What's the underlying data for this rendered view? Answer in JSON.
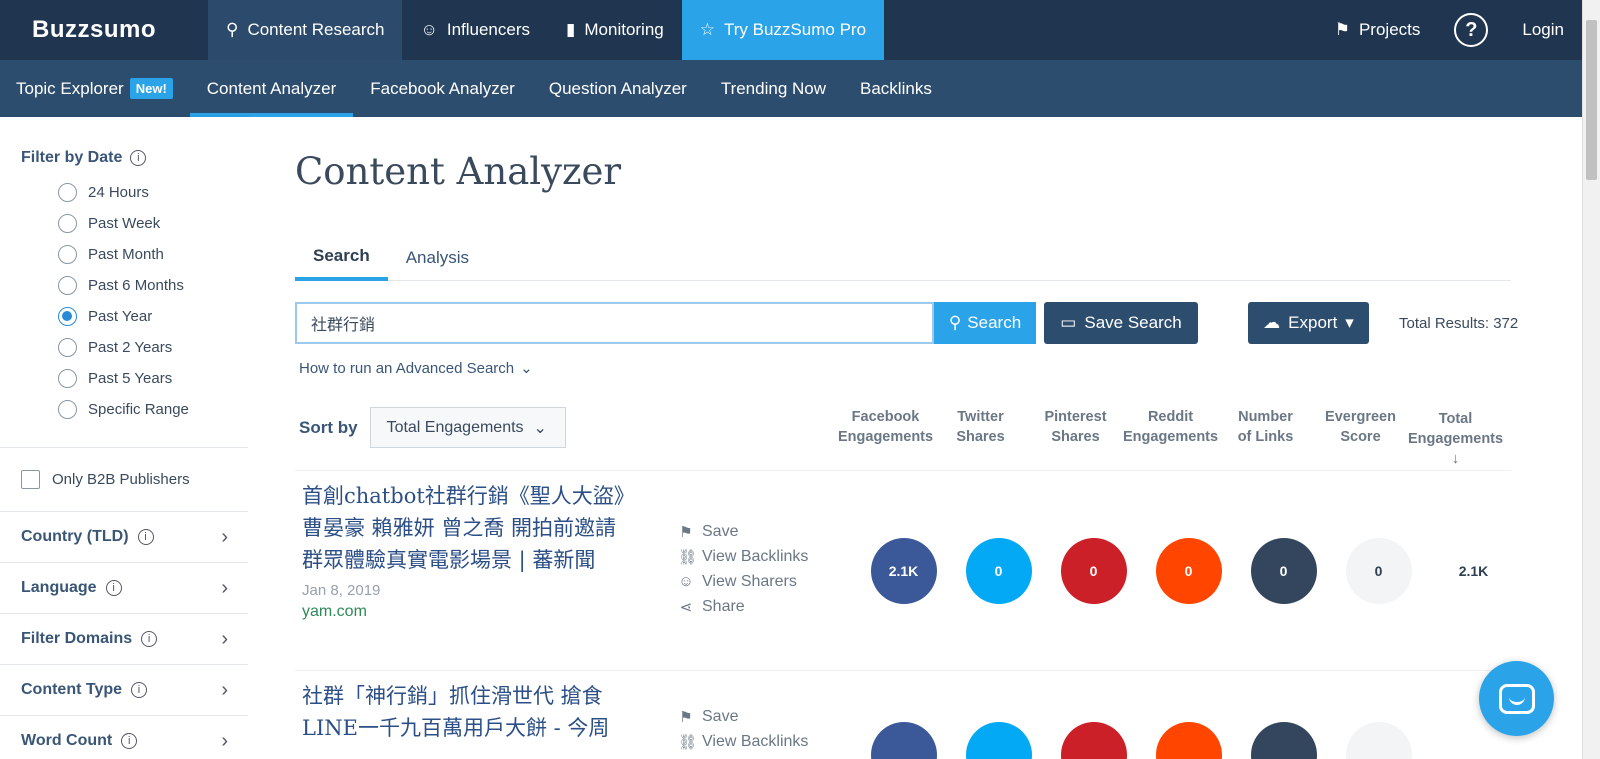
{
  "topnav": {
    "logo": "Buzzsumo",
    "items": [
      {
        "label": "Content Research",
        "icon": "search-icon",
        "active": true
      },
      {
        "label": "Influencers",
        "icon": "user-icon"
      },
      {
        "label": "Monitoring",
        "icon": "bar-chart-icon"
      },
      {
        "label": "Try BuzzSumo Pro",
        "icon": "star-icon",
        "pro": true
      }
    ],
    "projects": "Projects",
    "help": "?",
    "login": "Login"
  },
  "subnav": {
    "topic_explorer": "Topic Explorer",
    "new_badge": "New!",
    "items": [
      "Content Analyzer",
      "Facebook Analyzer",
      "Question Analyzer",
      "Trending Now",
      "Backlinks"
    ]
  },
  "sidebar": {
    "filter_title": "Filter by Date",
    "date_options": [
      "24 Hours",
      "Past Week",
      "Past Month",
      "Past 6 Months",
      "Past Year",
      "Past 2 Years",
      "Past 5 Years",
      "Specific Range"
    ],
    "selected_date": "Past Year",
    "b2b_label": "Only B2B Publishers",
    "sections": [
      "Country (TLD)",
      "Language",
      "Filter Domains",
      "Content Type",
      "Word Count"
    ]
  },
  "main": {
    "title": "Content Analyzer",
    "tabs": [
      "Search",
      "Analysis"
    ],
    "search_value": "社群行銷",
    "search_button": "Search",
    "save_search": "Save Search",
    "export": "Export",
    "total_results": "Total Results: 372",
    "advanced": "How to run an Advanced Search",
    "sort_by": "Sort by",
    "sort_value": "Total Engagements",
    "columns": [
      [
        "Facebook",
        "Engagements"
      ],
      [
        "Twitter",
        "Shares"
      ],
      [
        "Pinterest",
        "Shares"
      ],
      [
        "Reddit",
        "Engagements"
      ],
      [
        "Number",
        "of Links"
      ],
      [
        "Evergreen",
        "Score"
      ],
      [
        "Total",
        "Engagements ↓"
      ]
    ],
    "actions": [
      "Save",
      "View Backlinks",
      "View Sharers",
      "Share"
    ],
    "results": [
      {
        "title": "首創chatbot社群行銷《聖人大盜》曹晏豪 賴雅妍 曾之喬 開拍前邀請群眾體驗真實電影場景 | 蕃新聞",
        "date": "Jan 8, 2019",
        "domain": "yam.com",
        "facebook": "2.1K",
        "twitter": "0",
        "pinterest": "0",
        "reddit": "0",
        "links": "0",
        "evergreen": "0",
        "total": "2.1K"
      },
      {
        "title": "社群「神行銷」抓住滑世代 搶食LINE一千九百萬用戶大餅 - 今周",
        "date": "",
        "domain": "",
        "facebook": "",
        "twitter": "",
        "pinterest": "",
        "reddit": "",
        "links": "",
        "evergreen": "",
        "total": ""
      }
    ]
  },
  "colors": {
    "nav_dark": "#1f3550",
    "nav_sub": "#2d4d6f",
    "accent": "#2aa3e8",
    "facebook": "#3b5998",
    "twitter": "#03a9f4",
    "pinterest": "#cb2027",
    "reddit": "#ff4500",
    "links": "#34465d"
  }
}
